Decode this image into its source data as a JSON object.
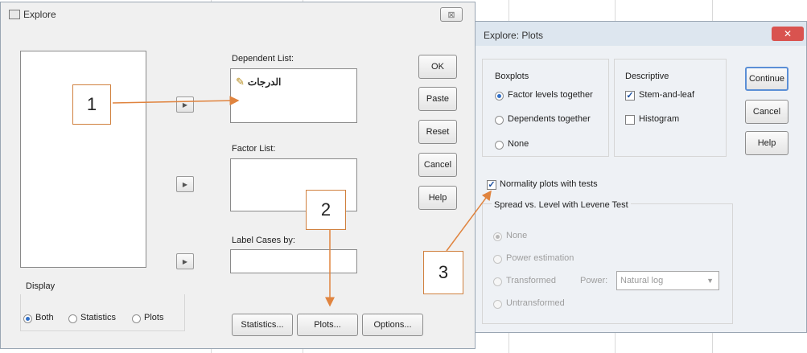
{
  "explore": {
    "title": "Explore",
    "dependent_list_label": "Dependent List:",
    "dependent_item": "الدرجات",
    "factor_list_label": "Factor List:",
    "label_cases_label": "Label Cases by:",
    "display_label": "Display",
    "display_options": [
      "Both",
      "Statistics",
      "Plots"
    ],
    "display_selected": "Both",
    "buttons": {
      "ok": "OK",
      "paste": "Paste",
      "reset": "Reset",
      "cancel": "Cancel",
      "help": "Help"
    },
    "bottom_buttons": {
      "statistics": "Statistics...",
      "plots": "Plots...",
      "options": "Options..."
    },
    "close_glyph": "⊠"
  },
  "plots": {
    "title": "Explore: Plots",
    "boxplots_label": "Boxplots",
    "boxplot_options": [
      "Factor levels together",
      "Dependents together",
      "None"
    ],
    "boxplot_selected": "Factor levels together",
    "descriptive_label": "Descriptive",
    "stem_and_leaf": {
      "label": "Stem-and-leaf",
      "checked": true
    },
    "histogram": {
      "label": "Histogram",
      "checked": false
    },
    "normality": {
      "label": "Normality plots with tests",
      "checked": true
    },
    "spread_label": "Spread vs. Level with Levene Test",
    "spread_options": [
      "None",
      "Power estimation",
      "Transformed",
      "Untransformed"
    ],
    "spread_selected": "None",
    "power_label": "Power:",
    "power_value": "Natural log",
    "buttons": {
      "continue": "Continue",
      "cancel": "Cancel",
      "help": "Help"
    },
    "close_glyph": "✕"
  },
  "callouts": [
    "1",
    "2",
    "3"
  ],
  "colors": {
    "arrow": "#e0843f",
    "close_red": "#d9534f",
    "selected_radio": "#2f6fc8"
  }
}
